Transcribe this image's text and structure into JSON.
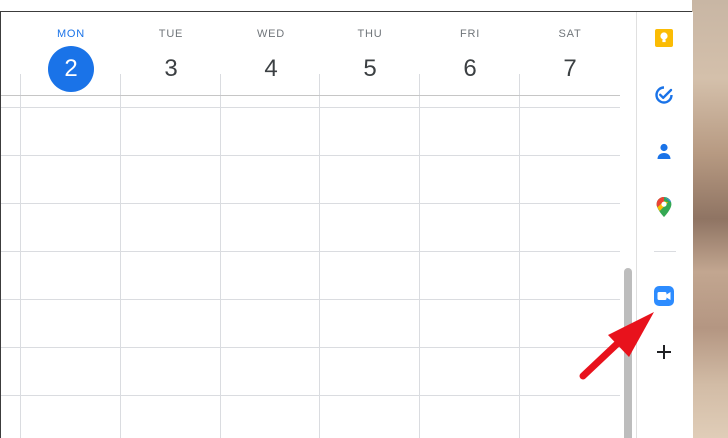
{
  "calendar": {
    "days": [
      {
        "name": "MON",
        "number": "2",
        "today": true
      },
      {
        "name": "TUE",
        "number": "3",
        "today": false
      },
      {
        "name": "WED",
        "number": "4",
        "today": false
      },
      {
        "name": "THU",
        "number": "5",
        "today": false
      },
      {
        "name": "FRI",
        "number": "6",
        "today": false
      },
      {
        "name": "SAT",
        "number": "7",
        "today": false
      }
    ]
  },
  "side_panel": {
    "items": [
      {
        "name": "keep",
        "icon": "keep-icon"
      },
      {
        "name": "tasks",
        "icon": "tasks-icon"
      },
      {
        "name": "contacts",
        "icon": "contacts-icon"
      },
      {
        "name": "maps",
        "icon": "maps-icon"
      },
      {
        "name": "zoom",
        "icon": "zoom-icon"
      },
      {
        "name": "add",
        "icon": "plus-icon"
      }
    ]
  },
  "colors": {
    "today_accent": "#1a73e8",
    "annotation_arrow": "#e8121c"
  }
}
